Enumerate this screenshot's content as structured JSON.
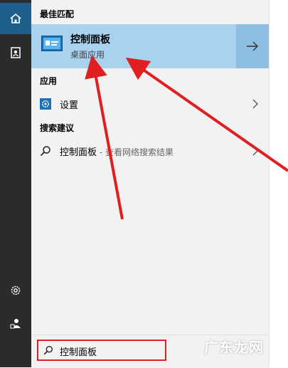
{
  "rail": {
    "items": [
      {
        "icon": "home-icon",
        "active": true
      },
      {
        "icon": "document-icon",
        "active": false
      },
      {
        "icon": "gear-icon",
        "active": false
      },
      {
        "icon": "user-icon",
        "active": false
      }
    ]
  },
  "sections": {
    "best_match": "最佳匹配",
    "apps": "应用",
    "suggestions": "搜索建议"
  },
  "best_match": {
    "title": "控制面板",
    "subtitle": "桌面应用"
  },
  "apps": [
    {
      "label": "设置"
    }
  ],
  "suggestions": [
    {
      "label": "控制面板",
      "hint": " - 查看网络搜索结果"
    }
  ],
  "search": {
    "value": "控制面板"
  },
  "watermark": "广东龙网",
  "colors": {
    "annotation": "#e02020",
    "highlight": "#a9d2ef",
    "rail": "#2b2b2b"
  }
}
